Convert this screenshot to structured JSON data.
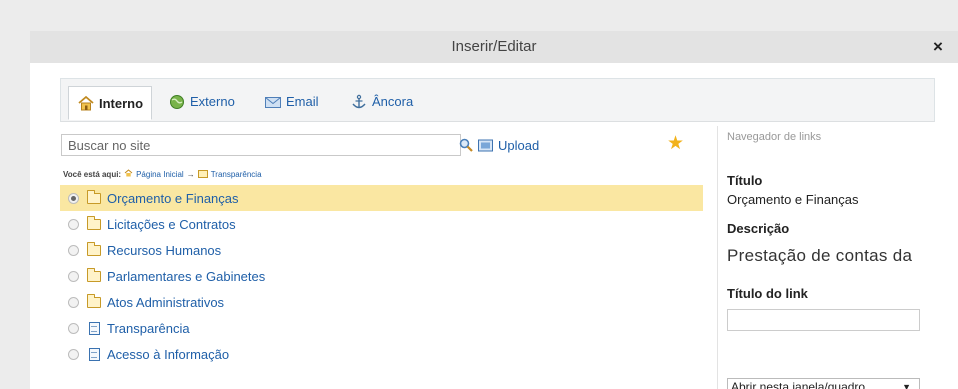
{
  "window": {
    "title": "Inserir/Editar",
    "close_label": "×"
  },
  "tabs": [
    {
      "label": "Interno",
      "icon": "home-icon",
      "active": true
    },
    {
      "label": "Externo",
      "icon": "globe-icon",
      "active": false
    },
    {
      "label": "Email",
      "icon": "email-icon",
      "active": false
    },
    {
      "label": "Âncora",
      "icon": "anchor-icon",
      "active": false
    }
  ],
  "search": {
    "placeholder": "Buscar no site",
    "value": ""
  },
  "upload_label": "Upload",
  "breadcrumb": {
    "prefix": "Você está aqui:",
    "items": [
      "Página Inicial",
      "Transparência"
    ],
    "separator": "→"
  },
  "items": [
    {
      "label": "Orçamento e Finanças",
      "type": "folder",
      "selected": true
    },
    {
      "label": "Licitações e Contratos",
      "type": "folder",
      "selected": false
    },
    {
      "label": "Recursos Humanos",
      "type": "folder",
      "selected": false
    },
    {
      "label": "Parlamentares e Gabinetes",
      "type": "folder",
      "selected": false
    },
    {
      "label": "Atos Administrativos",
      "type": "folder",
      "selected": false
    },
    {
      "label": "Transparência",
      "type": "page",
      "selected": false
    },
    {
      "label": "Acesso à Informação",
      "type": "page",
      "selected": false
    }
  ],
  "sidebar": {
    "heading": "Navegador de links",
    "title_label": "Título",
    "title_value": "Orçamento e Finanças",
    "description_label": "Descrição",
    "description_value": "Prestação de contas da",
    "link_title_label": "Título do link",
    "link_title_value": "",
    "target_value": "Abrir nesta janela/quadro"
  },
  "colors": {
    "accent": "#1f5fa8",
    "selected_row": "#fae7a2",
    "star": "#f2b21b"
  }
}
